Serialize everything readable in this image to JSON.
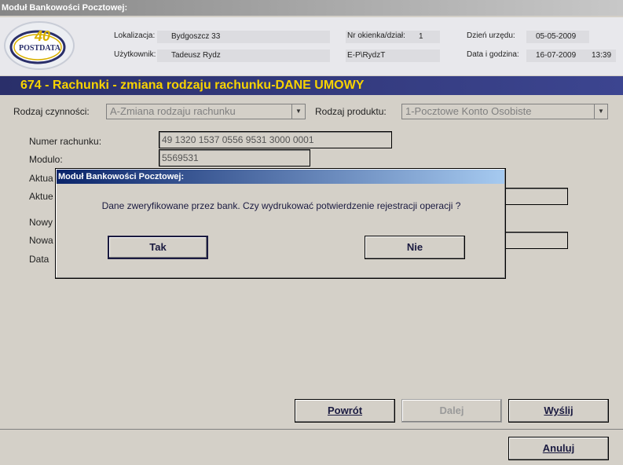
{
  "window": {
    "title": "Moduł Bankowości Pocztowej:"
  },
  "logo": {
    "text": "POSTDATA",
    "number": "40"
  },
  "header": {
    "lokalizacja_label": "Lokalizacja:",
    "lokalizacja_value": "Bydgoszcz 33",
    "okienko_label": "Nr okienka/dział:",
    "okienko_value": "1",
    "dzien_label": "Dzień urzędu:",
    "dzien_value": "05-05-2009",
    "uzytkownik_label": "Użytkownik:",
    "uzytkownik_value": "Tadeusz Rydz",
    "login_value": "E-P\\RydzT",
    "data_godzina_label": "Data i godzina:",
    "data_value": "16-07-2009",
    "godzina_value": "13:39"
  },
  "section": {
    "title": "674 - Rachunki - zmiana rodzaju rachunku-DANE UMOWY"
  },
  "form": {
    "rodzaj_czynnosci_label": "Rodzaj czynności:",
    "rodzaj_czynnosci_value": "A-Zmiana rodzaju rachunku",
    "rodzaj_produktu_label": "Rodzaj produktu:",
    "rodzaj_produktu_value": "1-Pocztowe Konto Osobiste",
    "numer_rachunku_label": "Numer rachunku:",
    "numer_rachunku_value": "49 1320 1537 0556 9531 3000 0001",
    "modulo_label": "Modulo:",
    "modulo_value": "5569531",
    "aktualny1_label": "Aktua",
    "aktualny2_label": "Aktue",
    "nowy_label": "Nowy",
    "nowa_label": "Nowa",
    "data_label": "Data"
  },
  "buttons": {
    "powrot": "Powrót",
    "dalej": "Dalej",
    "wyslij": "Wyślij",
    "anuluj": "Anuluj"
  },
  "dialog": {
    "title": "Moduł Bankowości Pocztowej:",
    "message": "Dane zweryfikowane przez bank. Czy wydrukować potwierdzenie rejestracji operacji ?",
    "yes": "Tak",
    "no": "Nie"
  },
  "icons": {
    "combo_arrow": "chevron-down-icon"
  }
}
